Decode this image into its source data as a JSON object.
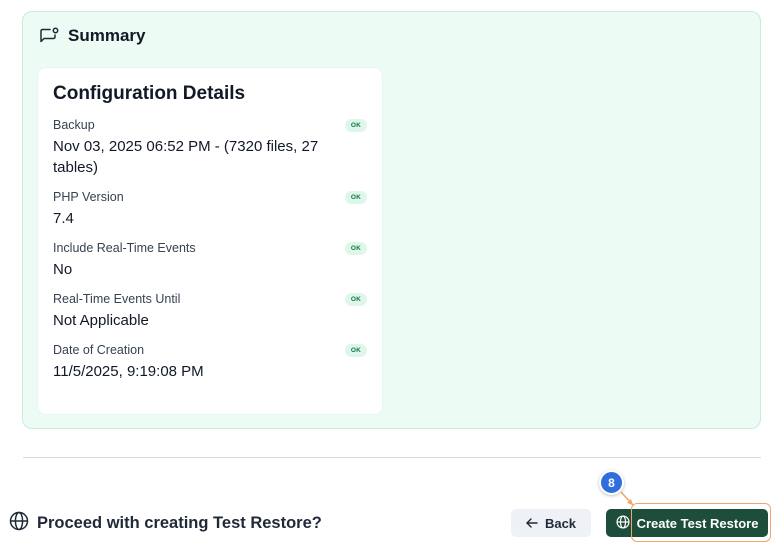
{
  "summary": {
    "title": "Summary",
    "icon": "message-square-icon"
  },
  "config": {
    "title": "Configuration Details",
    "badge_text": "OK",
    "items": [
      {
        "label": "Backup",
        "value": "Nov 03, 2025 06:52 PM - (7320 files, 27 tables)"
      },
      {
        "label": "PHP Version",
        "value": "7.4"
      },
      {
        "label": "Include Real-Time Events",
        "value": "No"
      },
      {
        "label": "Real-Time Events Until",
        "value": "Not Applicable"
      },
      {
        "label": "Date of Creation",
        "value": "11/5/2025, 9:19:08 PM"
      }
    ]
  },
  "footer": {
    "prompt": "Proceed with creating Test Restore?",
    "back_label": "Back",
    "create_label": "Create Test Restore"
  },
  "annotation": {
    "step_number": "8"
  },
  "colors": {
    "panel_bg": "#ecfbf3",
    "primary_button": "#1d4d3b",
    "ok_badge_text": "#0f7a44",
    "step_marker": "#2f6fdb",
    "highlight": "#f2a56b"
  }
}
